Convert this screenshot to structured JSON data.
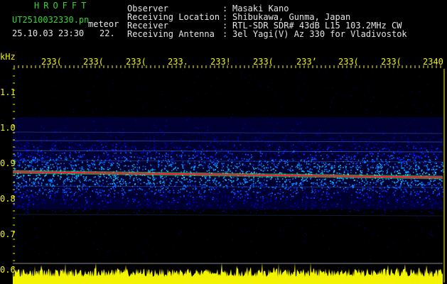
{
  "header": {
    "brand": "HROFFT",
    "file": "UT2510032330.pn",
    "file_suffix": "meteor",
    "datetime": "25.10.03 23:30",
    "channel": "22.",
    "fields": [
      {
        "label": "Observer",
        "value": "Masaki Kano"
      },
      {
        "label": "Receiving Location",
        "value": "Shibukawa, Gunma, Japan"
      },
      {
        "label": "Receiver",
        "value": "RTL-SDR SDR# 43dB L15 103.2MHz CW"
      },
      {
        "label": "Receiving Antenna",
        "value": "3el Yagi(V) Az 330 for Vladivostok"
      }
    ],
    "separator": ":"
  },
  "axes": {
    "y_unit": "kHz",
    "y_ticks": [
      "1.1",
      "1.0",
      "0.9",
      "0.8",
      "0.7",
      "0.6"
    ],
    "x_ticks": [
      "233(",
      "233(",
      "233(",
      "233.",
      "233!",
      "233(",
      "233’",
      "233(",
      "233(",
      "2340"
    ]
  },
  "colors": {
    "background": "#000000",
    "header_green": "#35d535",
    "header_white": "#e6e6e6",
    "axis_yellow": "#f3f300",
    "noise_blue": "#0000c8",
    "signal_red": "#ff1a3c"
  }
}
